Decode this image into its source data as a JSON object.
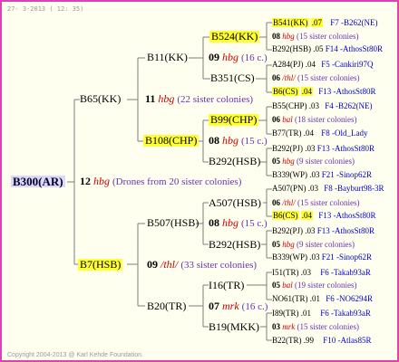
{
  "header": {
    "date": "27-  3-2013 ( 12: 35)"
  },
  "footer": {
    "copyright": "Copyright 2004-2013 @ Karl Kehde Foundation."
  },
  "root": {
    "name": "B300(AR)"
  },
  "gen1": {
    "mating_num": "12",
    "mating_type": "hbg",
    "note": "(Drones from 20 sister colonies)",
    "sire": "B65(KK)",
    "dam": "B7(HSB)"
  },
  "sire_side": {
    "mating_num": "11",
    "mating_type": "hbg",
    "note": "(22 sister colonies)",
    "sire": "B11(KK)",
    "dam": "B108(CHP)",
    "b11": {
      "mating_num": "09",
      "mating_type": "hbg",
      "note": "(16 c.)",
      "sire": "B524(KK)",
      "dam": "B351(CS)",
      "b524": {
        "line1": {
          "name": "B541(KK)",
          "num": ".07",
          "info": "F7 -B262(NE)"
        },
        "line2": {
          "num": "08",
          "type": "hbg",
          "note": "(15 sister colonies)"
        },
        "line3": {
          "name": "B292(HSB)",
          "num": ".05",
          "info": "F14 -AthosSt80R"
        }
      },
      "b351": {
        "line1": {
          "name": "A284(PJ)",
          "num": ".04",
          "info": "F5 -Cankiri97Q"
        },
        "line2": {
          "num": "06",
          "type": "/thl/",
          "note": "(15 sister colonies)"
        },
        "line3": {
          "name": "B6(CS)",
          "num": ".04",
          "info": "F13 -AthosSt80R"
        }
      }
    },
    "b108": {
      "mating_num": "08",
      "mating_type": "hbg",
      "note": "(15 c.)",
      "sire": "B99(CHP)",
      "dam": "B292(HSB)",
      "b99": {
        "line1": {
          "name": "B55(CHP)",
          "num": ".03",
          "info": "F4 -B262(NE)"
        },
        "line2": {
          "num": "06",
          "type": "bal",
          "note": "(18 sister colonies)"
        },
        "line3": {
          "name": "B77(TR)",
          "num": ".04",
          "info": "F8 -Old_Lady"
        }
      },
      "b292": {
        "line1": {
          "name": "B292(PJ)",
          "num": ".03",
          "info": "F13 -AthosSt80R"
        },
        "line2": {
          "num": "05",
          "type": "hbg",
          "note": "(9 sister colonies)"
        },
        "line3": {
          "name": "B339(WP)",
          "num": ".03",
          "info": "F21 -Sinop62R"
        }
      }
    }
  },
  "dam_side": {
    "mating_num": "09",
    "mating_type": "/thl/",
    "note": "(33 sister colonies)",
    "sire": "B507(HSB)",
    "dam": "B20(TR)",
    "b507": {
      "mating_num": "08",
      "mating_type": "hbg",
      "note": "(15 c.)",
      "sire": "A507(HSB)",
      "dam": "B292(HSB)",
      "a507": {
        "line1": {
          "name": "A507(PN)",
          "num": ".03",
          "info": "F8 -Bayburt98-3R"
        },
        "line2": {
          "num": "06",
          "type": "/thl/",
          "note": "(15 sister colonies)"
        },
        "line3": {
          "name": "B6(CS)",
          "num": ".04",
          "info": "F13 -AthosSt80R"
        }
      },
      "b292": {
        "line1": {
          "name": "B292(PJ)",
          "num": ".03",
          "info": "F13 -AthosSt80R"
        },
        "line2": {
          "num": "05",
          "type": "hbg",
          "note": "(9 sister colonies)"
        },
        "line3": {
          "name": "B339(WP)",
          "num": ".03",
          "info": "F21 -Sinop62R"
        }
      }
    },
    "b20": {
      "mating_num": "07",
      "mating_type": "mrk",
      "note": "(16 c.)",
      "sire": "I16(TR)",
      "dam": "B19(MKK)",
      "i16": {
        "line1": {
          "name": "I51(TR)",
          "num": ".03",
          "info": "F6 -Takab93aR"
        },
        "line2": {
          "num": "05",
          "type": "bal",
          "note": "(19 sister colonies)"
        },
        "line3": {
          "name": "NO61(TR)",
          "num": ".01",
          "info": "F6 -NO6294R"
        }
      },
      "b19": {
        "line1": {
          "name": "I89(TR)",
          "num": ".01",
          "info": "F6 -Takab93aR"
        },
        "line2": {
          "num": "03",
          "type": "mrk",
          "note": "(15 sister colonies)"
        },
        "line3": {
          "name": "B22(TR)",
          "num": ".99",
          "info": "F10 -Atlas85R"
        }
      }
    }
  }
}
